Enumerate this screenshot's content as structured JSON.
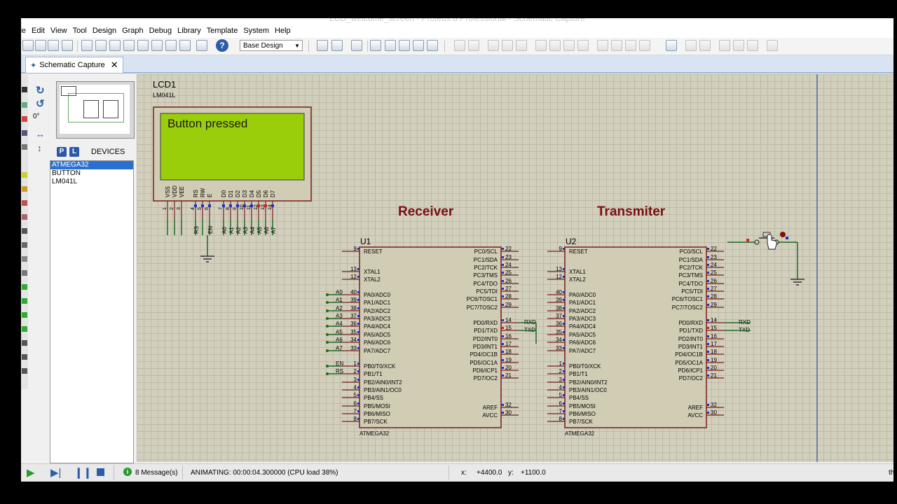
{
  "window": {
    "title": "LCD_welcome_screen - Proteus 8 Professional - Schematic Capture"
  },
  "menu": [
    "ile",
    "Edit",
    "View",
    "Tool",
    "Design",
    "Graph",
    "Debug",
    "Library",
    "Template",
    "System",
    "Help"
  ],
  "toolbar": {
    "design_select": "Base Design"
  },
  "tab": {
    "label": "Schematic Capture",
    "close": "✕"
  },
  "left_panel": {
    "rotation": "0°",
    "p_button": "P",
    "l_button": "L",
    "devices_heading": "DEVICES",
    "devices": [
      "ATMEGA32",
      "BUTTON",
      "LM041L"
    ],
    "selected_device": "ATMEGA32"
  },
  "lcd": {
    "ref": "LCD1",
    "part": "LM041L",
    "display_text": "Button pressed",
    "pin_names": [
      "VSS",
      "VDD",
      "VEE",
      "RS",
      "RW",
      "E",
      "D0",
      "D1",
      "D2",
      "D3",
      "D4",
      "D5",
      "D6",
      "D7"
    ],
    "pin_numbers": [
      "1",
      "2",
      "3",
      "4",
      "5",
      "6",
      "7",
      "8",
      "9",
      "10",
      "11",
      "12",
      "13",
      "14"
    ],
    "net_labels": [
      "RS",
      "EN",
      "A0",
      "A1",
      "A2",
      "A3",
      "A4",
      "A5",
      "A6",
      "A7"
    ]
  },
  "receiver": {
    "heading": "Receiver",
    "ref": "U1",
    "part": "ATMEGA32"
  },
  "transmitter": {
    "heading": "Transmiter",
    "ref": "U2",
    "part": "ATMEGA32"
  },
  "mcu": {
    "left_pins": [
      {
        "num": "9",
        "name": "RESET"
      },
      {
        "num": "13",
        "name": "XTAL1"
      },
      {
        "num": "12",
        "name": "XTAL2"
      },
      {
        "num": "40",
        "name": "PA0/ADC0"
      },
      {
        "num": "39",
        "name": "PA1/ADC1"
      },
      {
        "num": "38",
        "name": "PA2/ADC2"
      },
      {
        "num": "37",
        "name": "PA3/ADC3"
      },
      {
        "num": "36",
        "name": "PA4/ADC4"
      },
      {
        "num": "35",
        "name": "PA5/ADC5"
      },
      {
        "num": "34",
        "name": "PA6/ADC6"
      },
      {
        "num": "33",
        "name": "PA7/ADC7"
      },
      {
        "num": "1",
        "name": "PB0/T0/XCK"
      },
      {
        "num": "2",
        "name": "PB1/T1"
      },
      {
        "num": "3",
        "name": "PB2/AIN0/INT2"
      },
      {
        "num": "4",
        "name": "PB3/AIN1/OC0"
      },
      {
        "num": "5",
        "name": "PB4/SS"
      },
      {
        "num": "6",
        "name": "PB5/MOSI"
      },
      {
        "num": "7",
        "name": "PB6/MISO"
      },
      {
        "num": "8",
        "name": "PB7/SCK"
      }
    ],
    "right_pins": [
      {
        "num": "22",
        "name": "PC0/SCL"
      },
      {
        "num": "23",
        "name": "PC1/SDA"
      },
      {
        "num": "24",
        "name": "PC2/TCK"
      },
      {
        "num": "25",
        "name": "PC3/TMS"
      },
      {
        "num": "26",
        "name": "PC4/TDO"
      },
      {
        "num": "27",
        "name": "PC5/TDI"
      },
      {
        "num": "28",
        "name": "PC6/TOSC1"
      },
      {
        "num": "29",
        "name": "PC7/TOSC2"
      },
      {
        "num": "14",
        "name": "PD0/RXD"
      },
      {
        "num": "15",
        "name": "PD1/TXD"
      },
      {
        "num": "16",
        "name": "PD2/INT0"
      },
      {
        "num": "17",
        "name": "PD3/INT1"
      },
      {
        "num": "18",
        "name": "PD4/OC1B"
      },
      {
        "num": "19",
        "name": "PD5/OC1A"
      },
      {
        "num": "20",
        "name": "PD6/ICP1"
      },
      {
        "num": "21",
        "name": "PD7/OC2"
      },
      {
        "num": "32",
        "name": "AREF"
      },
      {
        "num": "30",
        "name": "AVCC"
      }
    ],
    "u1_net_labels": [
      "A0",
      "A1",
      "A2",
      "A3",
      "A4",
      "A5",
      "A6",
      "A7",
      "EN",
      "RS"
    ],
    "uart_labels": [
      "RXD",
      "TXD"
    ]
  },
  "status": {
    "messages": "8 Message(s)",
    "animating": "ANIMATING: 00:00:04.300000 (CPU load 38%)",
    "x_label": "x:",
    "x_value": "+4400.0",
    "y_label": "y:",
    "y_value": "+1100.0",
    "right_edge": "th"
  },
  "colors": {
    "sheet": "#d2cfbd",
    "component_body": "#d1ccb4",
    "component_outline": "#7a1c1c",
    "wire": "#1e6b1e",
    "heading": "#7a0f0f",
    "lcd_screen": "#9acd0a",
    "selection": "#2b70d0"
  }
}
